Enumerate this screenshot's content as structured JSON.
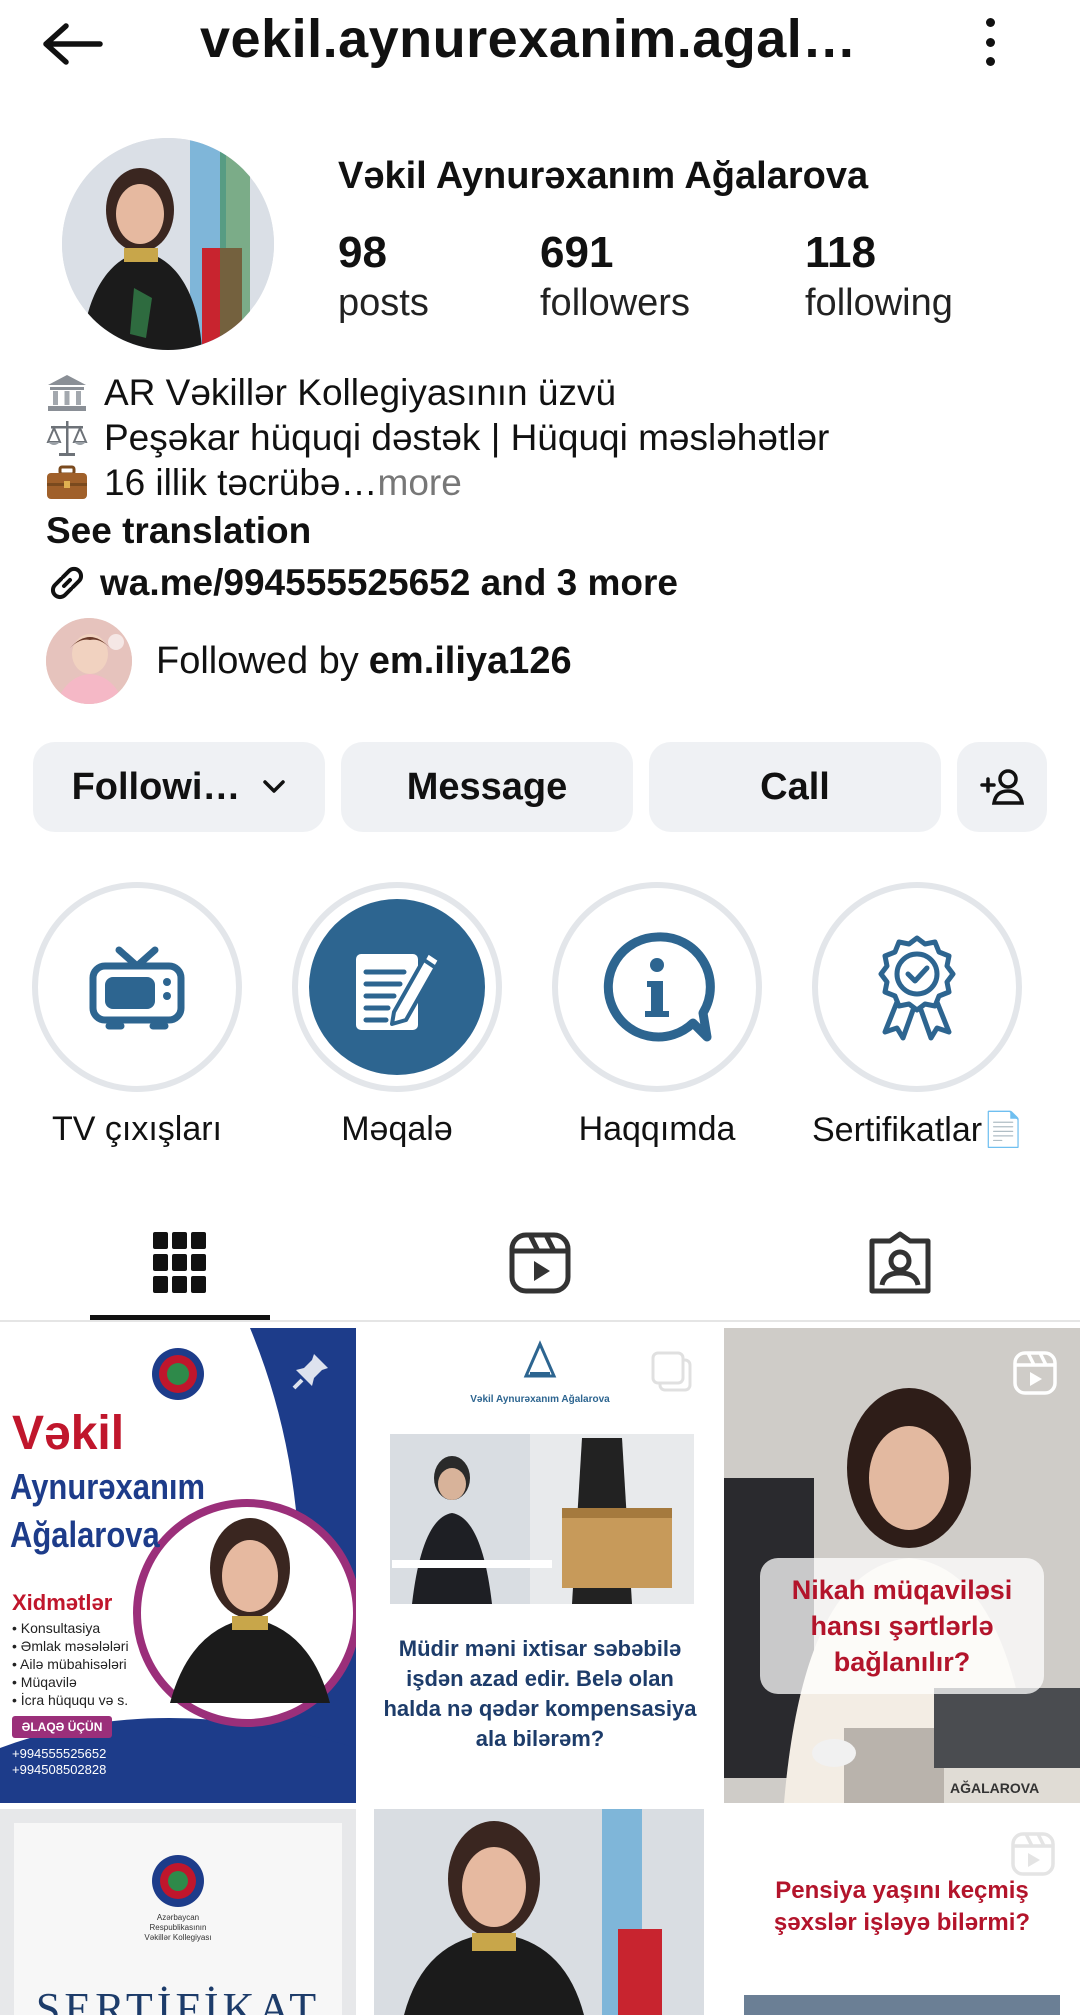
{
  "header": {
    "username": "vekil.aynurexanim.agal…"
  },
  "profile": {
    "display_name": "Vəkil Aynurəxanım Ağalarova",
    "stats": [
      {
        "value": "98",
        "label": "posts"
      },
      {
        "value": "691",
        "label": "followers"
      },
      {
        "value": "118",
        "label": "following"
      }
    ]
  },
  "bio": {
    "line1": "AR Vəkillər Kollegiyasının üzvü",
    "line2": "Peşəkar hüquqi dəstək | Hüquqi məsləhətlər",
    "line3": "16 illik təcrübə… ",
    "more": "more",
    "see_translation": "See translation",
    "link": "wa.me/994555525652 and 3 more",
    "followed_by_prefix": "Followed by",
    "followed_by_user": "em.iliya126"
  },
  "buttons": {
    "following": "Followi…",
    "message": "Message",
    "call": "Call"
  },
  "highlights": [
    {
      "label": "TV çıxışları",
      "icon": "tv-icon"
    },
    {
      "label": "Məqalə",
      "icon": "article-pen-icon"
    },
    {
      "label": "Haqqımda",
      "icon": "info-bubble-icon"
    },
    {
      "label": "Sertifikatlar📄",
      "icon": "award-badge-icon"
    }
  ],
  "tabs": [
    {
      "name": "grid-icon",
      "active": true
    },
    {
      "name": "reels-icon",
      "active": false
    },
    {
      "name": "tagged-icon",
      "active": false
    }
  ],
  "posts": {
    "p1": {
      "title1": "Vəkil",
      "title2": "Aynurəxanım",
      "title3": "Ağalarova",
      "services_heading": "Xidmətlər",
      "services": [
        "• Konsultasiya",
        "• Əmlak məsələləri",
        "• Ailə mübahisələri",
        "• Müqavilə",
        "• İcra hüququ və s."
      ],
      "contact_label": "ƏLAQƏ ÜÇÜN",
      "phone1": "+994555525652",
      "phone2": "+994508502828"
    },
    "p2": {
      "brand": "Vəkil Aynurəxanım Ağalarova",
      "caption": "Müdir məni ixtisar səbəbilə işdən azad edir. Belə olan halda nə qədər kompensasiya ala bilərəm?"
    },
    "p3": {
      "caption": "Nikah müqaviləsi hansı şərtlərlə bağlanılır?",
      "nameplate": "AĞALAROVA"
    },
    "p4": {
      "org": "Azərbaycan Respublikasının Vəkillər Kollegiyası",
      "title": "SERTİFİKAT"
    },
    "p6": {
      "caption": "Pensiya yaşını keçmiş şəxslər işləyə bilərmi?"
    }
  },
  "colors": {
    "accent_blue": "#2d6590",
    "button_bg": "#eff1f4",
    "post_red": "#c0162c",
    "post_navy": "#1d3c8a"
  }
}
